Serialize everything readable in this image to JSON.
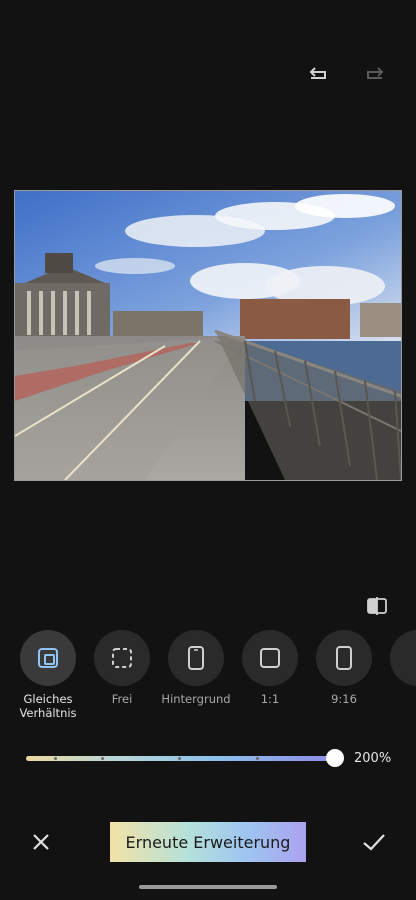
{
  "toolbar": {
    "undo_icon": "undo-icon",
    "redo_icon": "redo-icon"
  },
  "compare_icon": "compare-icon",
  "ratio_options": [
    {
      "label": "Gleiches\nVerhältnis",
      "icon": "same-ratio-icon",
      "selected": true
    },
    {
      "label": "Frei",
      "icon": "free-crop-icon",
      "selected": false
    },
    {
      "label": "Hintergrund",
      "icon": "phone-background-icon",
      "selected": false
    },
    {
      "label": "1:1",
      "icon": "square-icon",
      "selected": false
    },
    {
      "label": "9:16",
      "icon": "portrait-icon",
      "selected": false
    }
  ],
  "slider": {
    "value_label": "200%",
    "fraction": 1.0
  },
  "bottom": {
    "cancel_icon": "close-icon",
    "action_label": "Erneute Erweiterung",
    "confirm_icon": "check-icon"
  },
  "colors": {
    "background": "#121212",
    "accent_gradient": [
      "#f1e2a6",
      "#b5e1da",
      "#9fc4f1",
      "#a9a2ef"
    ],
    "selected_icon": "#8fc3f5"
  }
}
